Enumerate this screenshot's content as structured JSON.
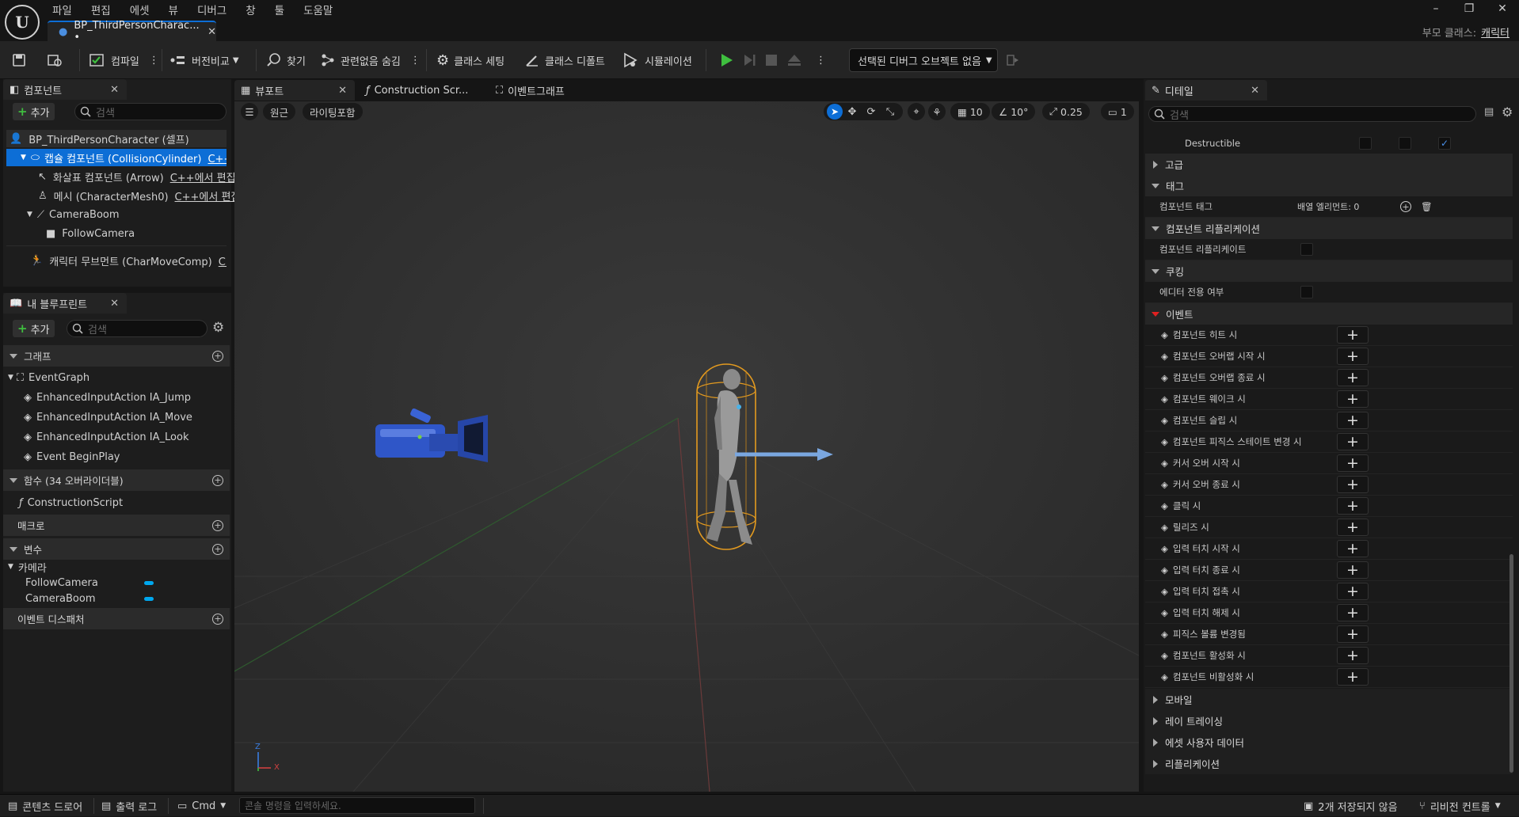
{
  "app": {
    "doc_tab": "BP_ThirdPersonCharac... •",
    "parent_class_label": "부모 클래스:",
    "parent_class_value": "캐릭터"
  },
  "menu": [
    "파일",
    "편집",
    "에셋",
    "뷰",
    "디버그",
    "창",
    "툴",
    "도움말"
  ],
  "toolbar": {
    "compile": "컴파일",
    "diff": "버전비교",
    "find": "찾기",
    "hide_unrelated": "관련없음 숨김",
    "class_settings": "클래스 세팅",
    "class_defaults": "클래스 디폴트",
    "simulation": "시뮬레이션",
    "debug_object": "선택된 디버그 오브젝트 없음"
  },
  "components": {
    "tab": "컴포넌트",
    "add": "추가",
    "search_placeholder": "검색",
    "root": "BP_ThirdPersonCharacter (셀프)",
    "capsule": "캡슐 컴포넌트 (CollisionCylinder)",
    "capsule_edit": "C++에서",
    "arrow": "화살표 컴포넌트 (Arrow)",
    "arrow_edit": "C++에서 편집",
    "mesh": "메시 (CharacterMesh0)",
    "mesh_edit": "C++에서 편집",
    "boom": "CameraBoom",
    "camera": "FollowCamera",
    "movement": "캐릭터 무브먼트 (CharMoveComp)",
    "movement_edit": "C++에"
  },
  "myblueprint": {
    "tab": "내 블루프린트",
    "add": "추가",
    "search_placeholder": "검색",
    "graphs": "그래프",
    "eventgraph": "EventGraph",
    "events": [
      "EnhancedInputAction IA_Jump",
      "EnhancedInputAction IA_Move",
      "EnhancedInputAction IA_Look",
      "Event BeginPlay"
    ],
    "functions": "함수 (34 오버라이더블)",
    "construction": "ConstructionScript",
    "macros": "매크로",
    "variables": "변수",
    "camera_cat": "카메라",
    "vars": [
      "FollowCamera",
      "CameraBoom"
    ],
    "dispatchers": "이벤트 디스패처"
  },
  "center_tabs": {
    "viewport": "뷰포트",
    "construction": "Construction Scr...",
    "eventgraph": "이벤트그래프"
  },
  "viewport": {
    "perspective": "원근",
    "lighting": "라이팅포함",
    "grid": "10",
    "rotation": "10°",
    "scale": "0.25",
    "camera_speed": "1",
    "axis_z": "Z",
    "axis_x": "X"
  },
  "details": {
    "tab": "디테일",
    "search_placeholder": "검색",
    "destructible": "Destructible",
    "advanced": "고급",
    "tags_section": "태그",
    "component_tags": "컴포넌트 태그",
    "array_elements": "배열 엘리먼트: 0",
    "replication_section": "컴포넌트 리플리케이션",
    "component_replicates": "컴포넌트 리플리케이트",
    "cooking_section": "쿠킹",
    "editor_only": "에디터 전용 여부",
    "events_section": "이벤트",
    "events": [
      "컴포넌트 히트 시",
      "컴포넌트 오버랩 시작 시",
      "컴포넌트 오버랩 종료 시",
      "컴포넌트 웨이크 시",
      "컴포넌트 슬립 시",
      "컴포넌트 피직스 스테이트 변경 시",
      "커서 오버 시작 시",
      "커서 오버 종료 시",
      "클릭 시",
      "릴리즈 시",
      "입력 터치 시작 시",
      "입력 터치 종료 시",
      "입력 터치 접촉 시",
      "입력 터치 해제 시",
      "피직스 볼륨 변경됨",
      "컴포넌트 활성화 시",
      "컴포넌트 비활성화 시"
    ],
    "collapsed": [
      "모바일",
      "레이 트레이싱",
      "에셋 사용자 데이터",
      "리플리케이션"
    ]
  },
  "status": {
    "content_drawer": "콘텐츠 드로어",
    "output_log": "출력 로그",
    "cmd": "Cmd",
    "console_placeholder": "콘솔 명령을 입력하세요.",
    "unsaved": "2개 저장되지 않음",
    "revision": "리비전 컨트롤"
  },
  "colors": {
    "accent": "#0d6ed6",
    "var_pill": "#00a7ee",
    "play": "#3fbf3f",
    "capsule_outline": "#e39a1f"
  }
}
